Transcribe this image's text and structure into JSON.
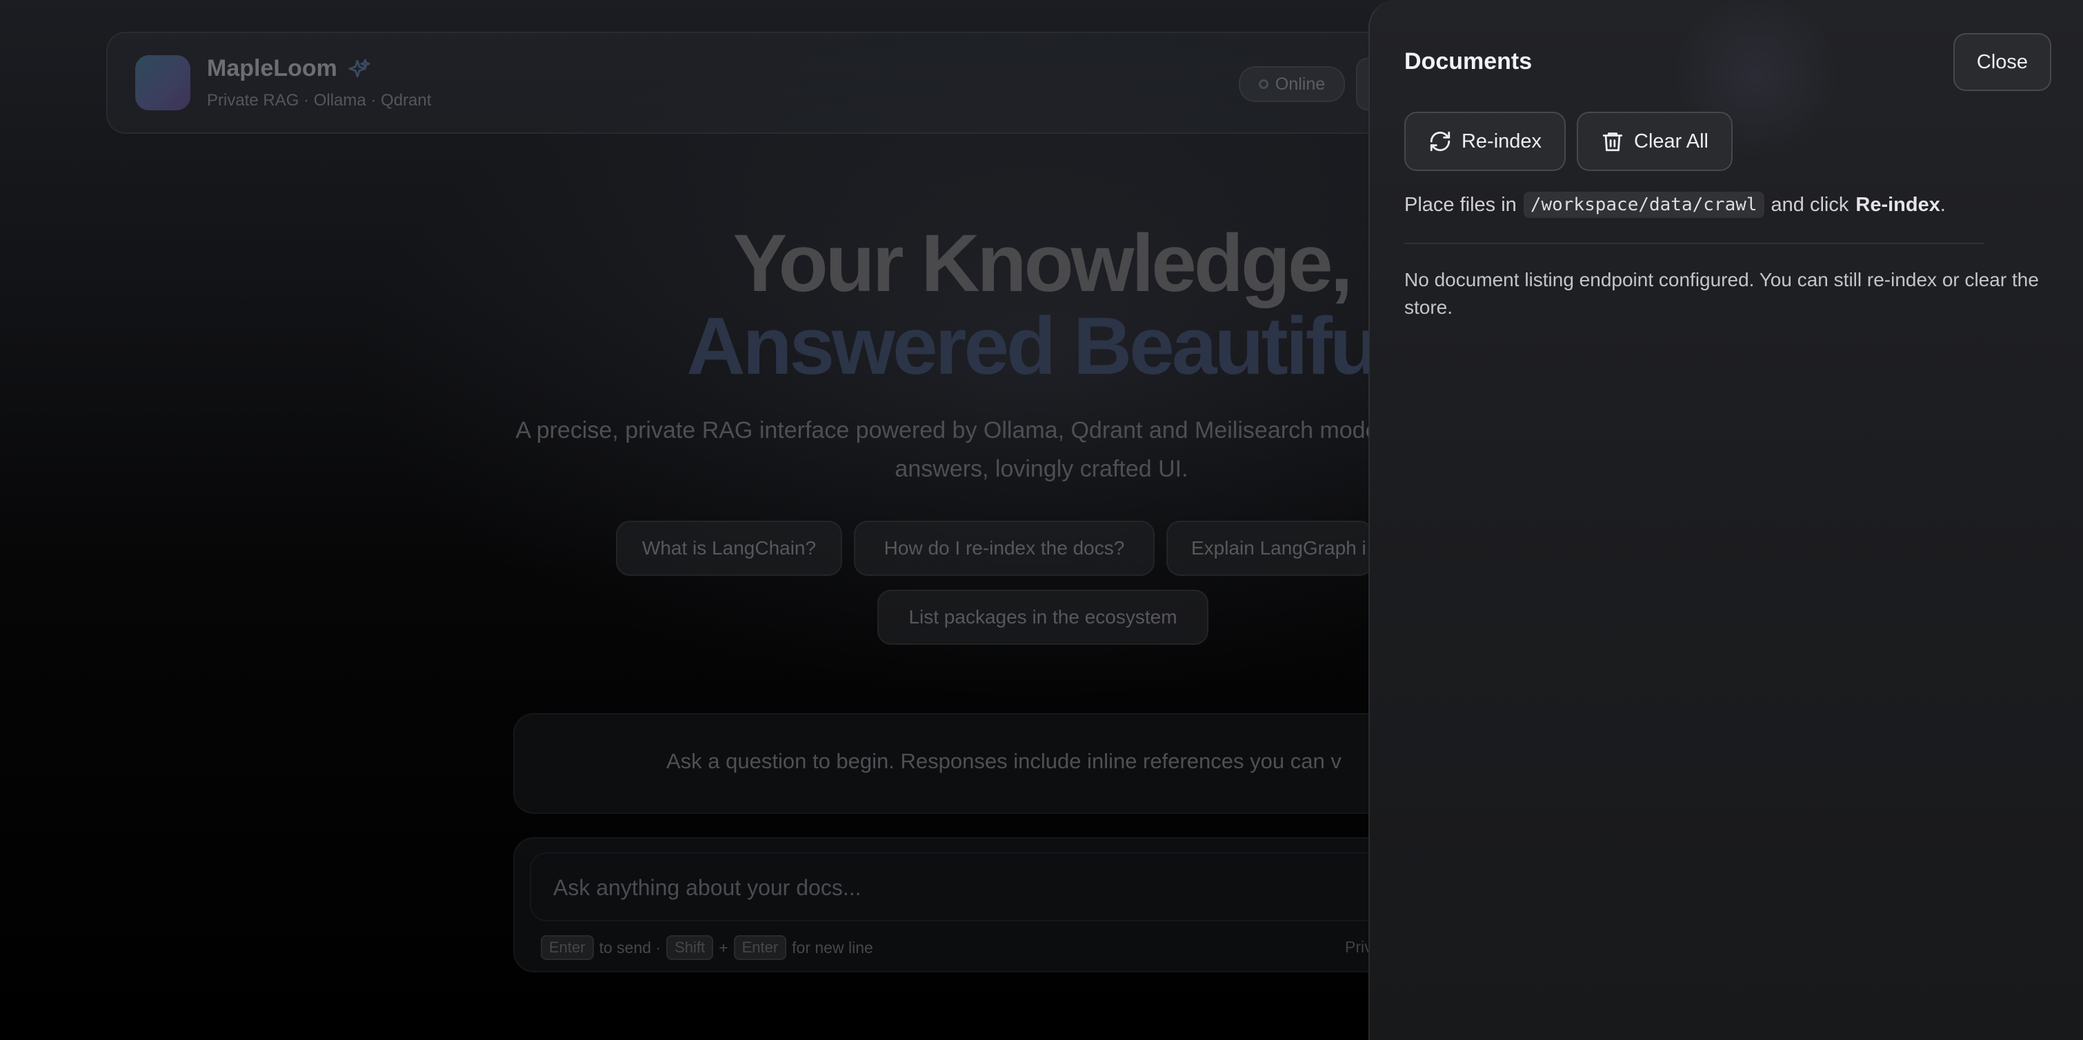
{
  "app": {
    "name": "MapleLoom",
    "subtitle": "Private RAG · Ollama · Qdrant",
    "status": "Online"
  },
  "hero": {
    "title_line1": "Your Knowledge,",
    "title_line2": "Answered Beautiful",
    "description": "A precise, private RAG interface powered by Ollama, Qdrant and Meilisearch mode, source-anchored answers, lovingly crafted UI."
  },
  "suggestions": [
    "What is LangChain?",
    "How do I re-index the docs?",
    "Explain LangGraph i",
    "List packages in the ecosystem"
  ],
  "chat": {
    "empty_state": "Ask a question to begin. Responses include inline references you can v",
    "input_placeholder": "Ask anything about your docs...",
    "hint_enter": "Enter",
    "hint_to_send": "to send ·",
    "hint_shift": "Shift",
    "hint_plus": "+",
    "hint_enter2": "Enter",
    "hint_newline": "for new line",
    "privacy_stub": "Priv"
  },
  "drawer": {
    "title": "Documents",
    "close_label": "Close",
    "reindex_label": "Re-index",
    "clear_all_label": "Clear All",
    "instructions_prefix": "Place files in",
    "path": "/workspace/data/crawl",
    "instructions_mid": "and click",
    "instructions_action": "Re-index",
    "instructions_suffix": ".",
    "no_listing_message": "No document listing endpoint configured. You can still re-index or clear the store."
  },
  "colors": {
    "drawer_bg": "#1e1f22",
    "drawer_text": "#f2f2f4",
    "accent_logo": "#2e4a5b",
    "hero_accent": "#2c3448"
  },
  "icons": {
    "reindex": "refresh-icon",
    "clear_all": "trash-icon",
    "brand": "sparkle-icon",
    "status": "status-dot-icon"
  }
}
